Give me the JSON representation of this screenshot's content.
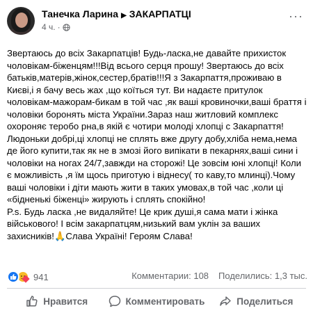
{
  "post": {
    "author": "Танечка Ларина",
    "group": "ЗАКАРПАТЦІ",
    "time": "4 ч.",
    "separator": "·",
    "more_label": "···",
    "text_main": "Звертаюсь до всіх Закарпатців! Будь-ласка,не давайте прихисток чоловікам-біженцям!!!Від всього серця прошу! Звертаюсь до всіх батьків,матерів,жінок,сестер,братів!!!Я з Закарпаття,проживаю в Києві,і я бачу весь жах ,що коїться тут. Ви надаєте притулок чоловікам-мажорам-бикам в той час ,як ваші кровиночки,ваші браття і чоловіки боронять міста України.Зараз наш житловий комплекс охороняє теробо рна,в якій є чотири молоді хлопці с Закарпаття!Людоньки добрі,ці хлопці не сплять вже другу добу,хліба нема,нема де його купити,так як не в змозі його випікати в пекарнях,ваші сини і чоловіки на ногах 24/7,завжди на сторожі! Це зовсім юні хлопці! Коли є можливість ,я їм щось приготую і віднесу( то каву,то млинці).Чому ваші чоловіки і діти мають жити в таких умовах,в той час ,коли ці «бідненькі біженці» жирують і сплять спокійно!",
    "text_ps": "P.s. Будь ласка ,не видаляйте! Це крик душі,я сама мати і жінка військового! І всім закарпатцям,низький вам уклін за ваших захисників!🙏Слава Україні! Героям Слава!"
  },
  "stats": {
    "reaction_count": "941",
    "comments": "Комментарии: 108",
    "shares": "Поделились: 1,3 тыс."
  },
  "actions": {
    "like": "Нравится",
    "comment": "Комментировать",
    "share": "Поделиться"
  },
  "colors": {
    "like_blue": "#1877f2",
    "care_yellow": "#f7b928",
    "secondary_text": "#65676b"
  }
}
